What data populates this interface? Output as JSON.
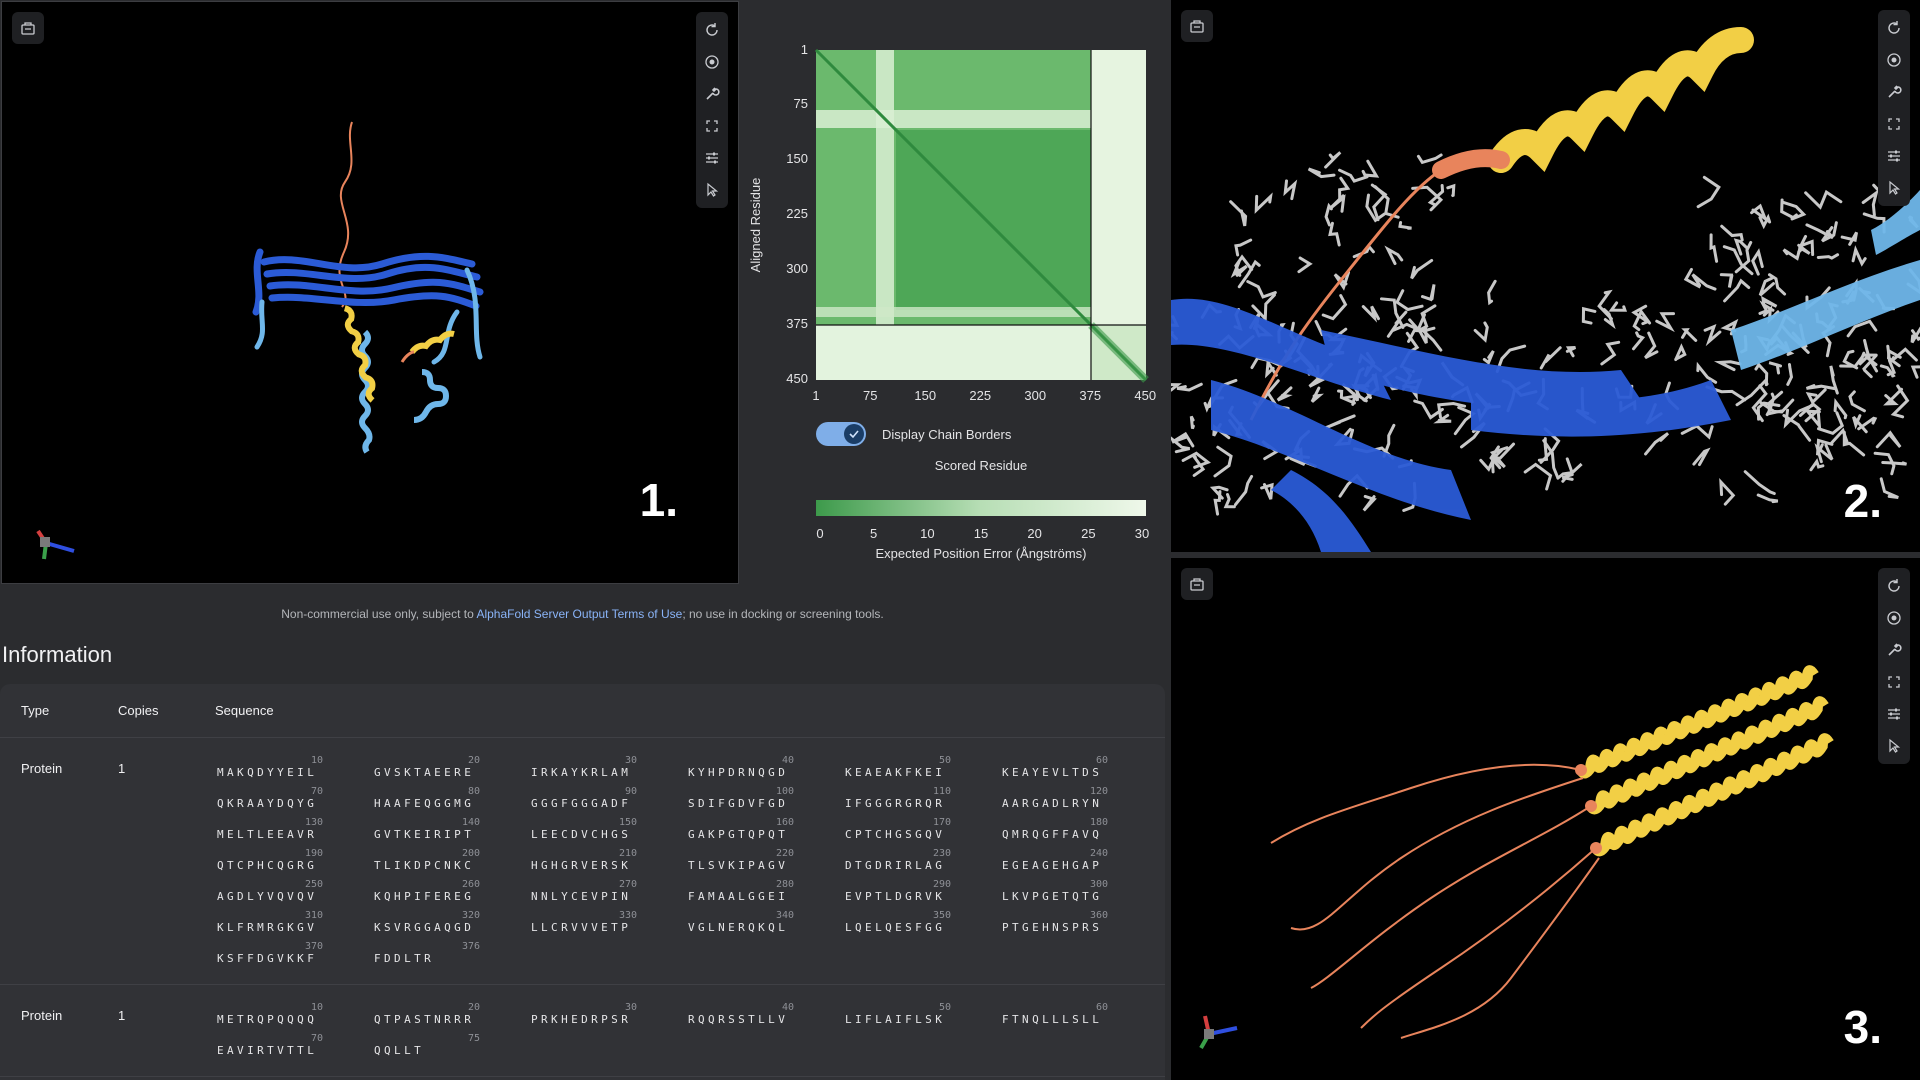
{
  "panels": {
    "viewer1_label": "1.",
    "viewer2_label": "2.",
    "viewer3_label": "3."
  },
  "viewer_tools": [
    "refresh-icon",
    "focus-icon",
    "wrench-icon",
    "fullscreen-icon",
    "sliders-icon",
    "pointer-icon"
  ],
  "pae": {
    "ylabel": "Aligned Residue",
    "yticks": [
      "1",
      "75",
      "150",
      "225",
      "300",
      "375",
      "450"
    ],
    "xticks": [
      "1",
      "75",
      "150",
      "225",
      "300",
      "375",
      "450"
    ],
    "chain_border": 376,
    "total": 451,
    "toggle_label": "Display Chain Borders",
    "toggle_on": true,
    "scored_label": "Scored Residue",
    "colorbar_ticks": [
      "0",
      "5",
      "10",
      "15",
      "20",
      "25",
      "30"
    ],
    "colorbar_title": "Expected Position Error (Ångströms)",
    "colors": {
      "low": "#3d9a4b",
      "mid": "#b7deb5",
      "high": "#eff8ea"
    }
  },
  "notice": {
    "before": "Non-commercial use only, subject to ",
    "link": "AlphaFold Server Output Terms of Use",
    "after": "; no use in docking or screening tools."
  },
  "info": {
    "title": "Information",
    "headers": {
      "type": "Type",
      "copies": "Copies",
      "sequence": "Sequence"
    },
    "rows": [
      {
        "type": "Protein",
        "copies": "1",
        "blocks": [
          [
            "10",
            "MAKQDYYEIL"
          ],
          [
            "20",
            "GVSKTAEERE"
          ],
          [
            "30",
            "IRKAYKRLAM"
          ],
          [
            "40",
            "KYHPDRNQGD"
          ],
          [
            "50",
            "KEAEAKFKEI"
          ],
          [
            "60",
            "KEAYEVLTDS"
          ],
          [
            "70",
            "QKRAAYDQYG"
          ],
          [
            "80",
            "HAAFEQGGMG"
          ],
          [
            "90",
            "GGGFGGGADF"
          ],
          [
            "100",
            "SDIFGDVFGD"
          ],
          [
            "110",
            "IFGGGRGRQR"
          ],
          [
            "120",
            "AARGADLRYN"
          ],
          [
            "130",
            "MELTLEEAVR"
          ],
          [
            "140",
            "GVTKEIRIPT"
          ],
          [
            "150",
            "LEECDVCHGS"
          ],
          [
            "160",
            "GAKPGTQPQT"
          ],
          [
            "170",
            "CPTCHGSGQV"
          ],
          [
            "180",
            "QMRQGFFAVQ"
          ],
          [
            "190",
            "QTCPHCQGRG"
          ],
          [
            "200",
            "TLIKDPCNKC"
          ],
          [
            "210",
            "HGHGRVERSK"
          ],
          [
            "220",
            "TLSVKIPAGV"
          ],
          [
            "230",
            "DTGDRIRLAG"
          ],
          [
            "240",
            "EGEAGEHGAP"
          ],
          [
            "250",
            "AGDLYVQVQV"
          ],
          [
            "260",
            "KQHPIFEREG"
          ],
          [
            "270",
            "NNLYCEVPIN"
          ],
          [
            "280",
            "FAMAALGGEI"
          ],
          [
            "290",
            "EVPTLDGRVK"
          ],
          [
            "300",
            "LKVPGETQTG"
          ],
          [
            "310",
            "KLFRMRGKGV"
          ],
          [
            "320",
            "KSVRGGAQGD"
          ],
          [
            "330",
            "LLCRVVVETP"
          ],
          [
            "340",
            "VGLNERQKQL"
          ],
          [
            "350",
            "LQELQESFGG"
          ],
          [
            "360",
            "PTGEHNSPRS"
          ],
          [
            "370",
            "KSFFDGVKKF"
          ],
          [
            "376",
            "FDDLTR"
          ]
        ]
      },
      {
        "type": "Protein",
        "copies": "1",
        "blocks": [
          [
            "10",
            "METRQPQQQQ"
          ],
          [
            "20",
            "QTPASTNRRR"
          ],
          [
            "30",
            "PRKHEDRPSR"
          ],
          [
            "40",
            "RQQRSSTLLV"
          ],
          [
            "50",
            "LIFLAIFLSK"
          ],
          [
            "60",
            "FTNQLLLSLL"
          ],
          [
            "70",
            "EAVIRTVTTL"
          ],
          [
            "75",
            "QQLLT"
          ]
        ]
      }
    ]
  }
}
